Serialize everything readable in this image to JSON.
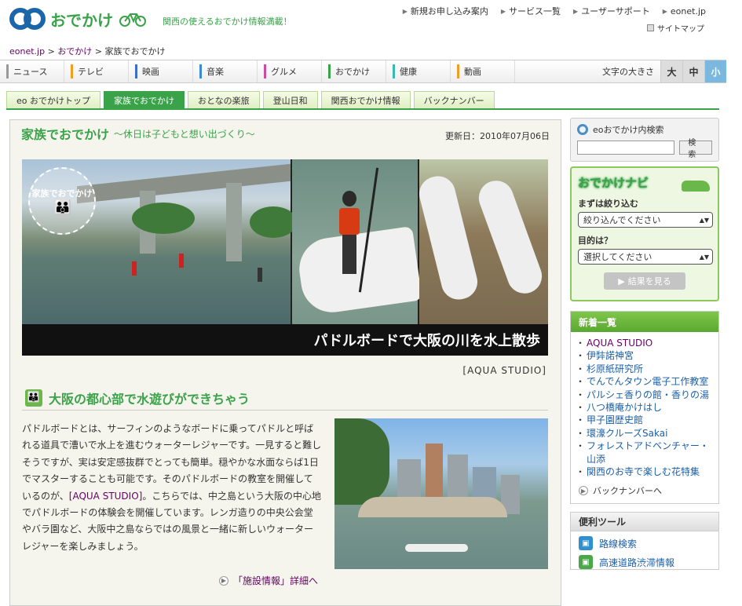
{
  "header": {
    "logo_text": "おでかけ",
    "tagline": "関西の使えるおでかけ情報満載！",
    "top_links": [
      "新規お申し込み案内",
      "サービス一覧",
      "ユーザーサポート",
      "eonet.jp"
    ],
    "sitemap": "サイトマップ"
  },
  "breadcrumb": {
    "items": [
      "eonet.jp",
      "おでかけ",
      "家族でおでかけ"
    ],
    "sep": " > "
  },
  "main_nav": {
    "items": [
      {
        "label": "ニュース",
        "color": "#999999"
      },
      {
        "label": "テレビ",
        "color": "#f0a020"
      },
      {
        "label": "映画",
        "color": "#3a6ec8"
      },
      {
        "label": "音楽",
        "color": "#3a8ad8"
      },
      {
        "label": "グルメ",
        "color": "#d04aa0"
      },
      {
        "label": "おでかけ",
        "color": "#3aa34a"
      },
      {
        "label": "健康",
        "color": "#3ab8b0"
      },
      {
        "label": "動画",
        "color": "#f0a020"
      }
    ],
    "font_size_label": "文字の大きさ",
    "font_sizes": [
      "大",
      "中",
      "小"
    ]
  },
  "sub_nav": {
    "items": [
      "eo おでかけトップ",
      "家族でおでかけ",
      "おとなの楽旅",
      "登山日和",
      "関西おでかけ情報",
      "バックナンバー"
    ],
    "active_index": 1
  },
  "article": {
    "title": "家族でおでかけ",
    "subtitle": "～休日は子どもと想い出づくり～",
    "updated": "更新日：2010年07月06日",
    "badge_text": "家族でおでかけ",
    "banner_caption": "パドルボードで大阪の川を水上散歩",
    "banner_credit": "[AQUA STUDIO]",
    "section_title": "大阪の都心部で水遊びができちゃう",
    "body_before_link": "パドルボードとは、サーフィンのようなボードに乗ってパドルと呼ばれる道具で漕いで水上を進むウォーターレジャーです。一見すると難しそうですが、実は安定感抜群でとっても簡単。穏やかな水面ならば1日でマスターすることも可能です。そのパドルボードの教室を開催しているのが、",
    "body_link": "[AQUA STUDIO]",
    "body_after_link": "。こちらでは、中之島という大阪の中心地でパドルボードの体験会を開催しています。レンガ造りの中央公会堂やバラ園など、大阪中之島ならではの風景と一緒に新しいウォーターレジャーを楽しみましょう。",
    "more_link": "「施設情報」詳細へ"
  },
  "sidebar": {
    "search": {
      "title": "eoおでかけ内検索",
      "button": "検索",
      "value": ""
    },
    "navi": {
      "title": "おでかけナビ",
      "label1": "まずは絞り込む",
      "select1": "絞り込んでください",
      "label2": "目的は？",
      "select2": "選択してください",
      "button": "結果を見る"
    },
    "news": {
      "title": "新着一覧",
      "items": [
        "AQUA STUDIO",
        "伊弉諾神宮",
        "杉原紙研究所",
        "でんでんタウン電子工作教室",
        "パルシェ香りの館・香りの湯",
        "八つ橋庵かけはし",
        "甲子園歴史館",
        "環濠クルーズSakai",
        "フォレストアドベンチャー・山添",
        "関西のお寺で楽しむ花特集"
      ],
      "backnumber": "バックナンバーへ"
    },
    "tools": {
      "title": "便利ツール",
      "items": [
        "路線検索",
        "高速道路渋滞情報"
      ]
    }
  },
  "colors": {
    "brand_green": "#3aa34a",
    "brand_blue": "#1a66a8",
    "link_purple": "#660066"
  }
}
